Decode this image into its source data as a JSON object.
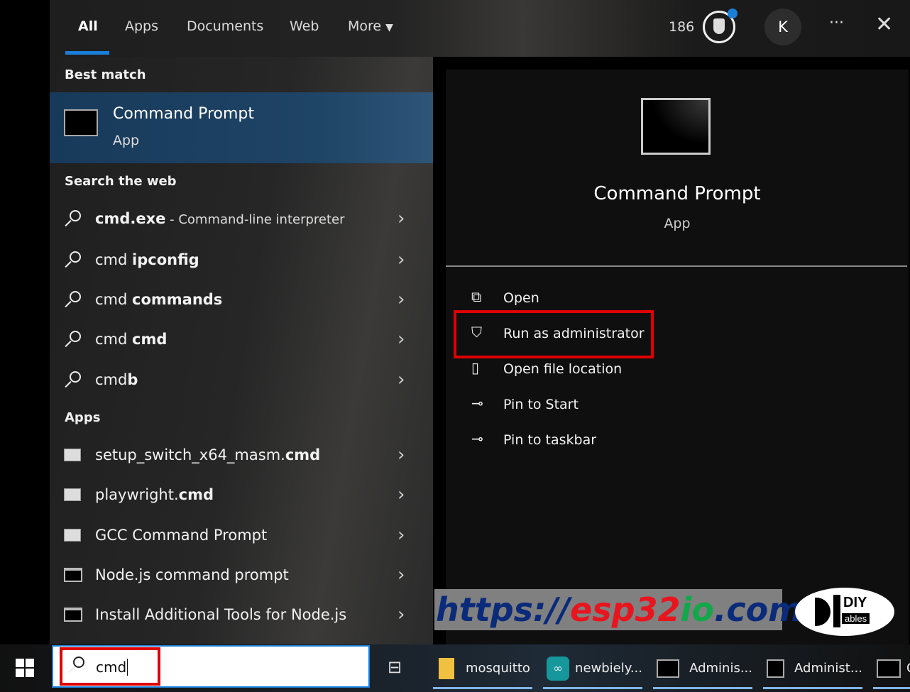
{
  "tabs": [
    {
      "label": "All",
      "active": true
    },
    {
      "label": "Apps"
    },
    {
      "label": "Documents"
    },
    {
      "label": "Web"
    },
    {
      "label": "More"
    }
  ],
  "header": {
    "points": "186",
    "avatar_letter": "K",
    "more_icon": "ellipsis-icon",
    "close_icon": "close-icon",
    "accent": "#1a7fd9"
  },
  "best_match": {
    "heading": "Best match",
    "title": "Command Prompt",
    "subtitle": "App"
  },
  "web": {
    "heading": "Search the web",
    "items": [
      {
        "prefix": "cmd.exe",
        "bold_prefix": true,
        "suffix": " - Command-line interpreter"
      },
      {
        "prefix": "cmd ",
        "suffix": "ipconfig"
      },
      {
        "prefix": "cmd ",
        "suffix": "commands"
      },
      {
        "prefix": "cmd ",
        "suffix": "cmd"
      },
      {
        "prefix": "cmd",
        "suffix": "b"
      }
    ]
  },
  "apps": {
    "heading": "Apps",
    "items": [
      {
        "prefix": "setup_switch_x64_masm.",
        "suffix": "cmd",
        "icon": "script-icon"
      },
      {
        "prefix": "playwright.",
        "suffix": "cmd",
        "icon": "gear-script-icon"
      },
      {
        "prefix": "GCC Command Prompt",
        "suffix": "",
        "icon": "script-icon"
      },
      {
        "prefix": "Node.js command prompt",
        "suffix": "",
        "icon": "console-icon"
      },
      {
        "prefix": "Install Additional Tools for Node.js",
        "suffix": "",
        "icon": "console-icon"
      }
    ]
  },
  "detail": {
    "title": "Command Prompt",
    "subtitle": "App",
    "actions": [
      {
        "label": "Open",
        "icon": "open-icon"
      },
      {
        "label": "Run as administrator",
        "icon": "shield-icon"
      },
      {
        "label": "Open file location",
        "icon": "folder-icon"
      },
      {
        "label": "Pin to Start",
        "icon": "pin-icon"
      },
      {
        "label": "Pin to taskbar",
        "icon": "pin-icon"
      }
    ]
  },
  "search": {
    "value": "cmd"
  },
  "taskbar": {
    "items": [
      {
        "label": "mosquitto",
        "icon": "folder-icon"
      },
      {
        "label": "newbiely...",
        "icon": "arduino-icon"
      },
      {
        "label": "Adminis...",
        "icon": "console-icon"
      },
      {
        "label": "Administ...",
        "icon": "console-icon"
      },
      {
        "label": "C",
        "icon": "console-icon"
      }
    ]
  },
  "watermark": {
    "part1": "https://",
    "part2": "esp32",
    "part3": "io",
    "part4": ".com",
    "logo": "DIY ables"
  },
  "highlight_color": "#e00000"
}
